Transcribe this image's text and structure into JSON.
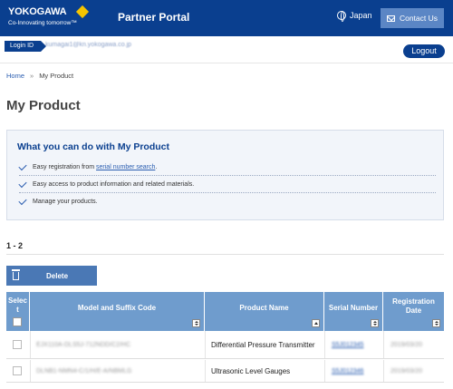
{
  "header": {
    "brand": "YOKOGAWA",
    "tagline": "Co-Innovating tomorrow™",
    "portal_title": "Partner Portal",
    "language": "Japan",
    "contact_label": "Contact Us",
    "colors": {
      "header_bg": "#0a3f8f",
      "accent": "#f5c400"
    }
  },
  "login": {
    "label": "Login ID",
    "email": "kumagai1@kn.yokogawa.co.jp",
    "logout_label": "Logout"
  },
  "breadcrumb": {
    "home": "Home",
    "separator": "»",
    "current": "My Product"
  },
  "page_title": "My Product",
  "info": {
    "heading": "What you can do with My Product",
    "items": [
      {
        "text_before": "Easy registration from ",
        "link": "serial number search",
        "text_after": "."
      },
      {
        "text_before": "Easy access to product information and related materials.",
        "link": "",
        "text_after": ""
      },
      {
        "text_before": "Manage your products.",
        "link": "",
        "text_after": ""
      }
    ]
  },
  "result_count": "1 - 2",
  "delete_label": "Delete",
  "table": {
    "headers": {
      "select": "Select",
      "model": "Model and Suffix Code",
      "product": "Product Name",
      "serial": "Serial Number",
      "registration": "Registration Date"
    },
    "rows": [
      {
        "model": "EJX110A-DLS5J-712NDD/C2/HC",
        "product": "Differential Pressure Transmitter",
        "serial": "S5J012345",
        "date": "2019/03/20"
      },
      {
        "model": "DLNB1-NMN4-C/1/H/E-A/NBMLG",
        "product": "Ultrasonic Level Gauges",
        "serial": "S5J012346",
        "date": "2019/03/20"
      }
    ]
  }
}
